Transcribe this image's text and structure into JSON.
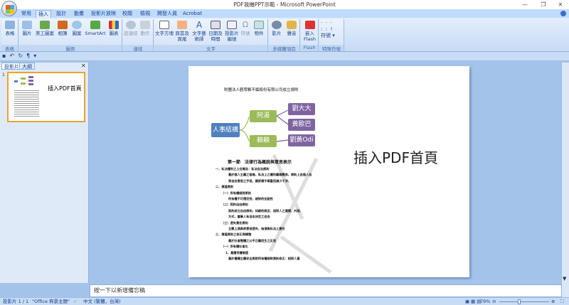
{
  "window": {
    "title": "PDF我機PPT示範 - Microsoft PowerPoint",
    "minimize": "—",
    "restore": "❐",
    "close": "✕"
  },
  "tabs": [
    "常用",
    "插入",
    "設計",
    "動畫",
    "投影片放映",
    "校閱",
    "檢視",
    "開發人員",
    "Acrobat"
  ],
  "ribbon": {
    "groups": [
      {
        "label": "表格",
        "buttons": [
          "表格"
        ]
      },
      {
        "label": "圖例",
        "buttons": [
          "圖片",
          "美工圖案",
          "相簿",
          "圖案",
          "SmartArt",
          "圖表"
        ]
      },
      {
        "label": "連結",
        "buttons": [
          "超連結",
          "動作"
        ]
      },
      {
        "label": "文字",
        "buttons": [
          "文字方塊",
          "頁首及頁尾",
          "文字藝術師",
          "日期及時間",
          "投影片編號",
          "符號",
          "物件"
        ]
      },
      {
        "label": "多媒體項目",
        "buttons": [
          "影片",
          "聲音"
        ]
      },
      {
        "label": "Flash",
        "buttons": [
          "嵌入 Flash"
        ]
      },
      {
        "label": "特殊符號",
        "buttons": [
          "符號"
        ]
      }
    ]
  },
  "leftpane": {
    "tabs": [
      "投影片",
      "大綱"
    ],
    "close": "✕",
    "slide_number": "1",
    "thumb_text": "插入PDF首頁"
  },
  "slide": {
    "doc_title": "財團法人觀眾郵不編殺份有限公司成立總則",
    "org": {
      "root": "人事結構",
      "mid": [
        "阿湯",
        "賴賴"
      ],
      "leaf": [
        "劉大大",
        "黃歐巴",
        "劉黃Odi"
      ]
    },
    "section_title": "第一節　法律行為概說與意思表示",
    "body_lines": [
      "一、私法權利之上位概念：私法自治原則",
      "基於個人主義之發展，私法上之權利義務關係，原則上由個人自",
      "我自由意思之手段，國家應予尊重而減少干涉。",
      "二、價值原則",
      "（一）所有權絕對原則",
      "所有權不可侵犯性，絕對的支配性",
      "（二）契約自由原則",
      "契約成立自由原則，如締約與否、相對人之選擇、內容、",
      "方式，當事人有自由決定之自由",
      "（三）過失責任原則",
      "主觀上須具故意或過失，始須負私法上責任",
      "三、價值原則之修正與調整",
      "基於社會整體之公平正義而生之反思",
      "（一）所有權社會化",
      "1、基層受權制度",
      "基於權權主義安全與財所有權絕對原則修正：相對人基"
    ],
    "main_text": "插入PDF首頁"
  },
  "notes_placeholder": "按一下以新增備忘稿",
  "status": {
    "slide": "投影片 1 / 1",
    "theme": "\"Office 佈景主題\"",
    "language": "中文 (繁體，台灣)",
    "zoom": "79%"
  }
}
